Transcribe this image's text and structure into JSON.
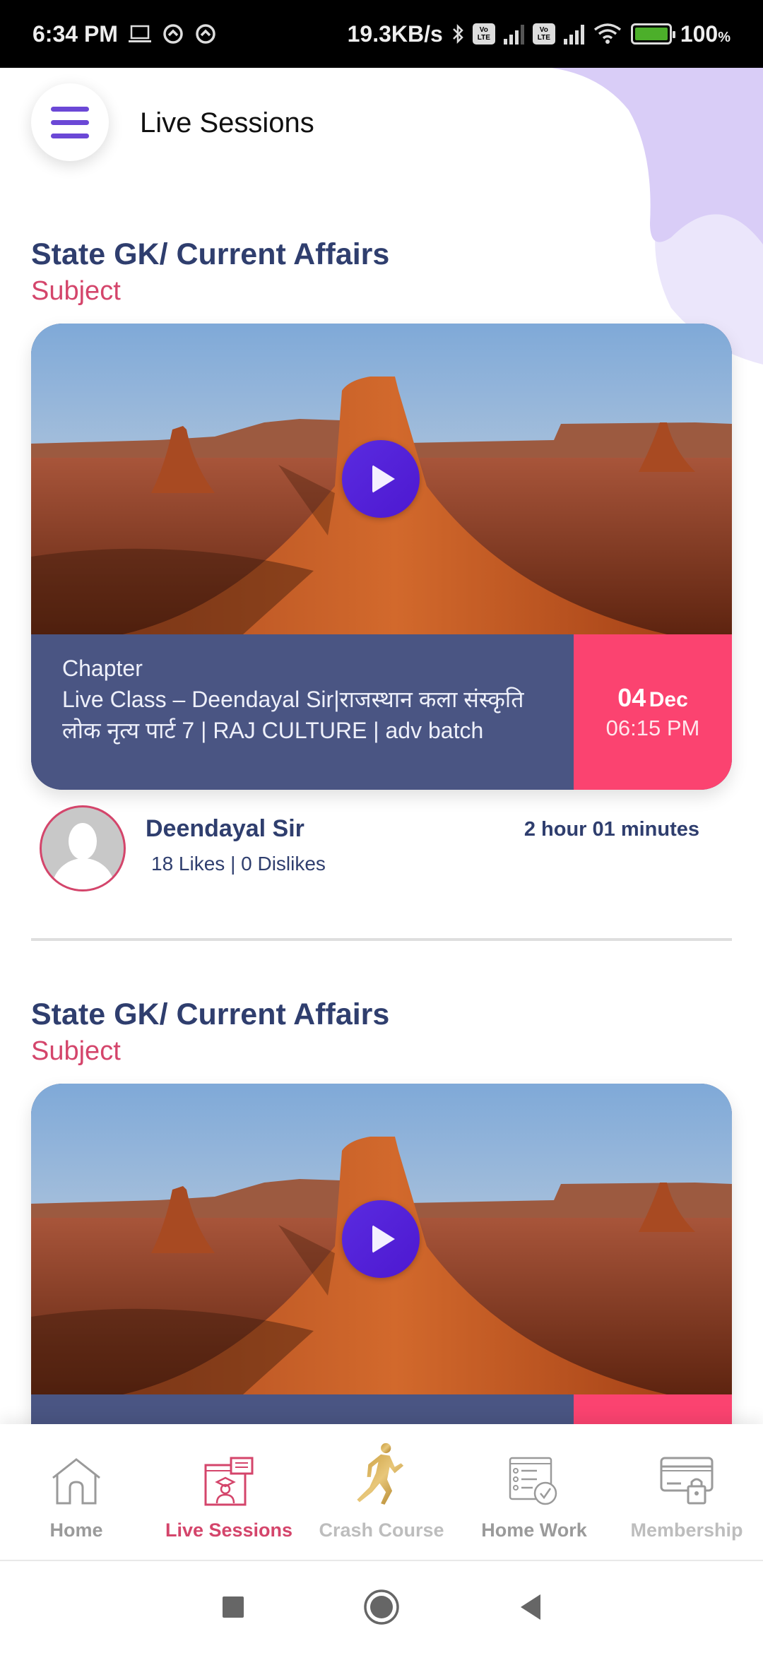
{
  "status_bar": {
    "time": "6:34 PM",
    "net_speed": "19.3KB/s",
    "volte_label_top": "Vo",
    "volte_label_bottom": "LTE",
    "battery_pct": "100",
    "pct_sign": "%",
    "icons": [
      "laptop-icon",
      "data-saver-icon",
      "data-saver-icon",
      "bluetooth-icon",
      "volte-icon",
      "signal-icon",
      "volte-icon",
      "signal-icon",
      "wifi-icon",
      "battery-charging-icon"
    ]
  },
  "header": {
    "title": "Live Sessions",
    "menu_icon": "hamburger-menu-icon"
  },
  "sessions": [
    {
      "subject_title": "State GK/ Current Affairs",
      "subject_label": "Subject",
      "chapter_label": "Chapter",
      "chapter_title": "Live Class – Deendayal Sir|राजस्थान कला संस्कृति लोक नृत्य पार्ट 7 | RAJ CULTURE | adv batch",
      "date_day": "04",
      "date_month": "Dec",
      "time": "06:15 PM",
      "teacher": "Deendayal Sir",
      "likes": "18 Likes |  0 Dislikes",
      "duration": "2 hour 01 minutes"
    },
    {
      "subject_title": "State GK/ Current Affairs",
      "subject_label": "Subject"
    }
  ],
  "bottom_nav": {
    "items": [
      {
        "label": "Home",
        "icon": "home-icon",
        "active": false
      },
      {
        "label": "Live Sessions",
        "icon": "live-sessions-icon",
        "active": true
      },
      {
        "label": "Crash Course",
        "icon": "runner-icon",
        "active": false
      },
      {
        "label": "Home Work",
        "icon": "homework-checklist-icon",
        "active": false
      },
      {
        "label": "Membership",
        "icon": "membership-card-icon",
        "active": false
      }
    ]
  },
  "colors": {
    "accent_purple": "#6b48d6",
    "title_navy": "#2f3e6e",
    "subject_pink": "#d4456b",
    "info_bg": "#4a5583",
    "date_bg": "#fb4370",
    "play_button": "#5224dc"
  }
}
